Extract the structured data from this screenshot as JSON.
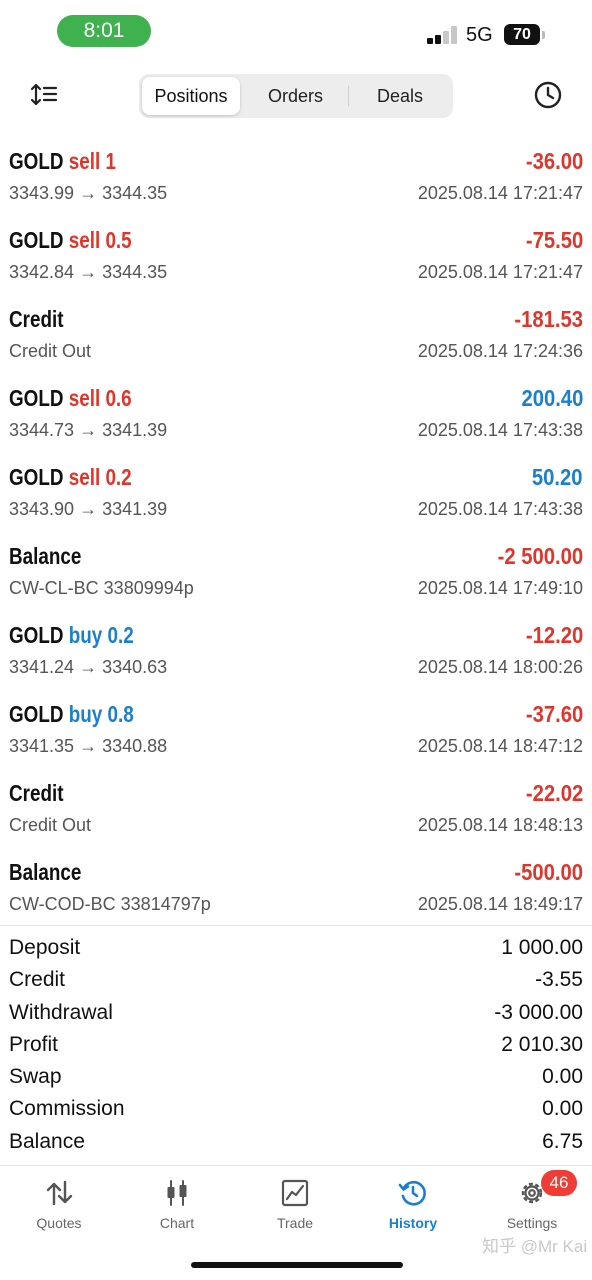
{
  "status_bar": {
    "time": "8:01",
    "network": "5G",
    "battery": "70",
    "colors": {
      "time_pill": "#3fb24f"
    }
  },
  "header": {
    "sort_icon": "sort-icon",
    "clock_icon": "clock-icon",
    "tabs": [
      {
        "label": "Positions",
        "active": true
      },
      {
        "label": "Orders",
        "active": false
      },
      {
        "label": "Deals",
        "active": false
      }
    ]
  },
  "deals": [
    {
      "symbol": "GOLD",
      "type": "sell",
      "volume": "1",
      "amount": "-36.00",
      "sign": "neg",
      "detail": "3343.99 → 3344.35",
      "time": "2025.08.14 17:21:47"
    },
    {
      "symbol": "GOLD",
      "type": "sell",
      "volume": "0.5",
      "amount": "-75.50",
      "sign": "neg",
      "detail": "3342.84 → 3344.35",
      "time": "2025.08.14 17:21:47"
    },
    {
      "symbol": "Credit",
      "type": "",
      "volume": "",
      "amount": "-181.53",
      "sign": "neg",
      "detail": "Credit Out",
      "time": "2025.08.14 17:24:36"
    },
    {
      "symbol": "GOLD",
      "type": "sell",
      "volume": "0.6",
      "amount": "200.40",
      "sign": "pos",
      "detail": "3344.73 → 3341.39",
      "time": "2025.08.14 17:43:38"
    },
    {
      "symbol": "GOLD",
      "type": "sell",
      "volume": "0.2",
      "amount": "50.20",
      "sign": "pos",
      "detail": "3343.90 → 3341.39",
      "time": "2025.08.14 17:43:38"
    },
    {
      "symbol": "Balance",
      "type": "",
      "volume": "",
      "amount": "-2 500.00",
      "sign": "neg",
      "detail": "CW-CL-BC 33809994p",
      "time": "2025.08.14 17:49:10"
    },
    {
      "symbol": "GOLD",
      "type": "buy",
      "volume": "0.2",
      "amount": "-12.20",
      "sign": "neg",
      "detail": "3341.24 → 3340.63",
      "time": "2025.08.14 18:00:26"
    },
    {
      "symbol": "GOLD",
      "type": "buy",
      "volume": "0.8",
      "amount": "-37.60",
      "sign": "neg",
      "detail": "3341.35 → 3340.88",
      "time": "2025.08.14 18:47:12"
    },
    {
      "symbol": "Credit",
      "type": "",
      "volume": "",
      "amount": "-22.02",
      "sign": "neg",
      "detail": "Credit Out",
      "time": "2025.08.14 18:48:13"
    },
    {
      "symbol": "Balance",
      "type": "",
      "volume": "",
      "amount": "-500.00",
      "sign": "neg",
      "detail": "CW-COD-BC 33814797p",
      "time": "2025.08.14 18:49:17"
    }
  ],
  "summary": [
    {
      "label": "Deposit",
      "value": "1 000.00"
    },
    {
      "label": "Credit",
      "value": "-3.55"
    },
    {
      "label": "Withdrawal",
      "value": "-3 000.00"
    },
    {
      "label": "Profit",
      "value": "2 010.30"
    },
    {
      "label": "Swap",
      "value": "0.00"
    },
    {
      "label": "Commission",
      "value": "0.00"
    },
    {
      "label": "Balance",
      "value": "6.75"
    }
  ],
  "bottom_nav": {
    "items": [
      {
        "label": "Quotes",
        "icon": "quotes-icon",
        "active": false
      },
      {
        "label": "Chart",
        "icon": "chart-icon",
        "active": false
      },
      {
        "label": "Trade",
        "icon": "trade-icon",
        "active": false
      },
      {
        "label": "History",
        "icon": "history-icon",
        "active": true
      },
      {
        "label": "Settings",
        "icon": "settings-icon",
        "active": false
      }
    ],
    "settings_badge": "46"
  },
  "watermark": "知乎 @Mr Kai",
  "colors": {
    "sell": "#e0352a",
    "buy": "#1a7fd0",
    "negative": "#e0352a",
    "positive": "#1a7fd0",
    "accent": "#1a7fd0",
    "badge": "#ef3d35"
  }
}
